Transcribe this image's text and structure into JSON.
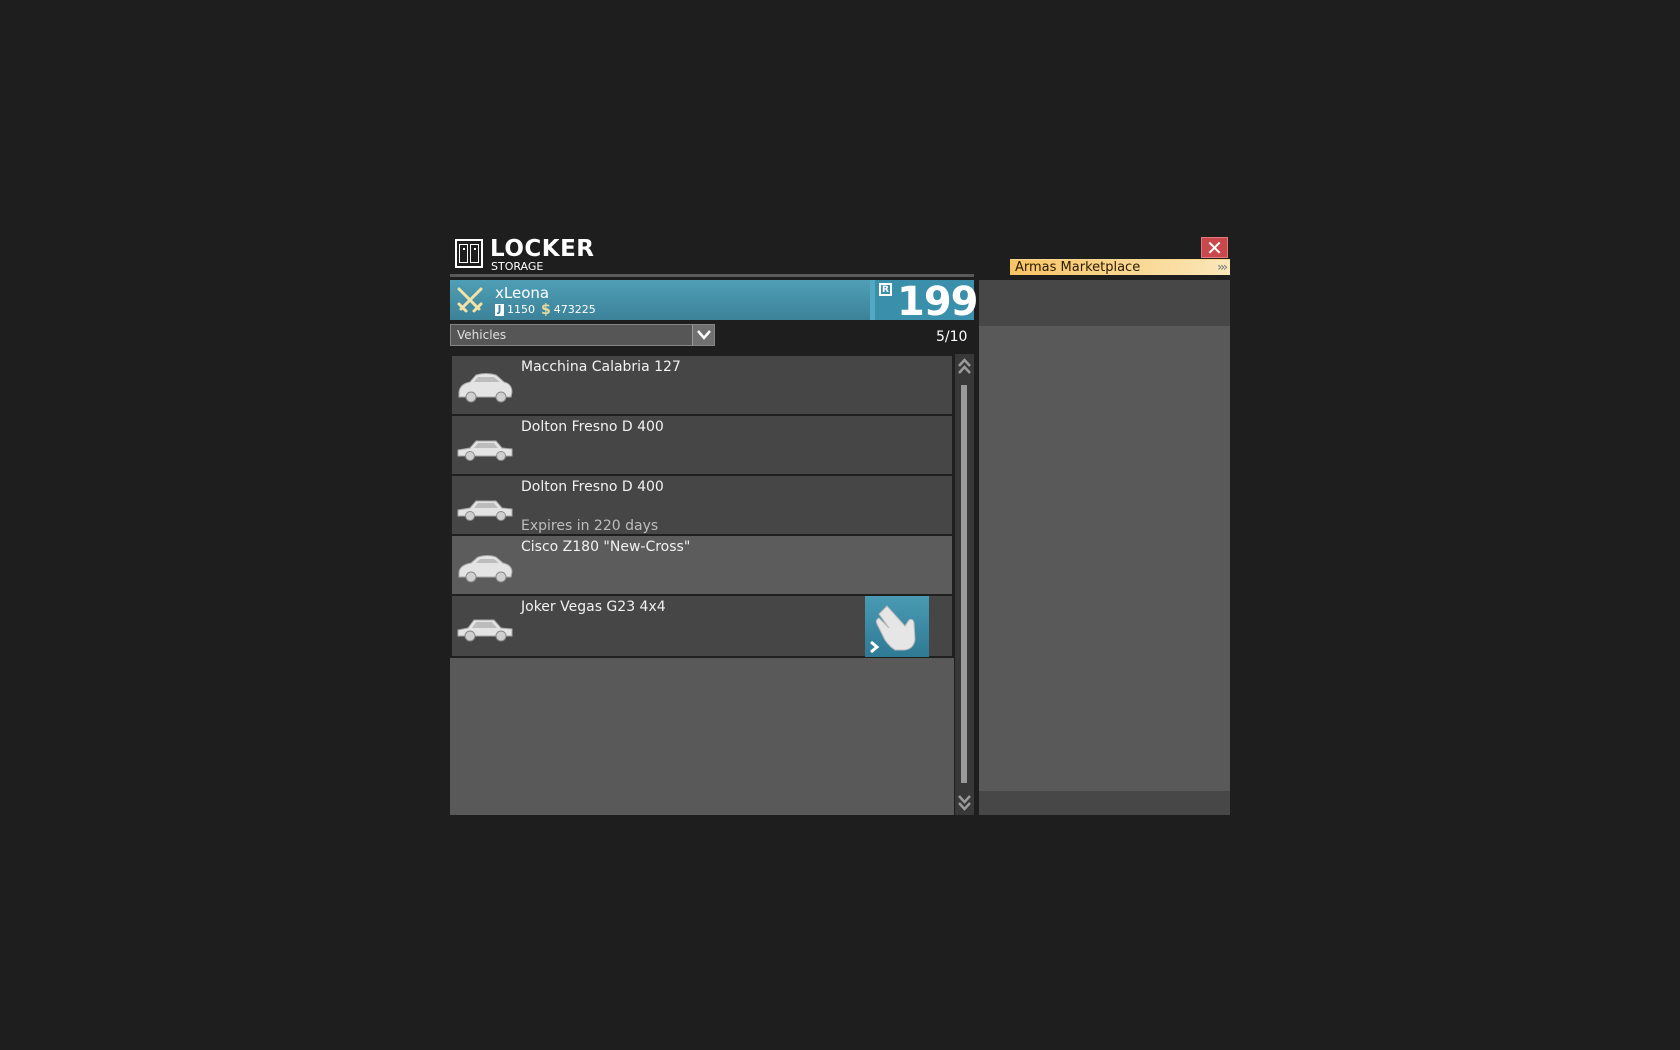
{
  "header": {
    "title": "LOCKER",
    "subtitle": "STORAGE",
    "icon": "locker-icon"
  },
  "marketplace": {
    "label": "Armas Marketplace",
    "arrows": "›››",
    "close_icon": "close-icon"
  },
  "player": {
    "name": "xLeona",
    "jcoins": "1150",
    "money": "473225",
    "rank": "199",
    "rank_icon_letter": "R",
    "accent": "#3c8299"
  },
  "filter": {
    "selected": "Vehicles"
  },
  "capacity": "5/10",
  "items": [
    {
      "name": "Macchina Calabria 127",
      "expires": ""
    },
    {
      "name": "Dolton Fresno D 400",
      "expires": ""
    },
    {
      "name": "Dolton Fresno D 400",
      "expires": "Expires in 220 days"
    },
    {
      "name": "Cisco Z180 \"New-Cross\"",
      "expires": ""
    },
    {
      "name": "Joker Vegas G23 4x4",
      "expires": ""
    }
  ]
}
